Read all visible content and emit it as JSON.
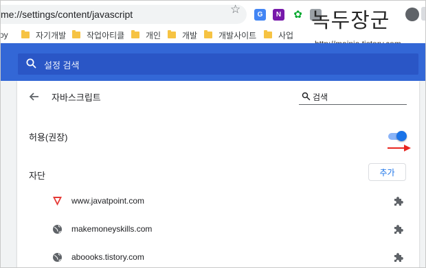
{
  "browser": {
    "url": "me://settings/content/javascript",
    "extensions": [
      {
        "name": "google-translate-icon",
        "glyph": "G",
        "color": "#4285f4"
      },
      {
        "name": "onenote-icon",
        "glyph": "N",
        "color": "#7719aa"
      },
      {
        "name": "evernote-icon",
        "glyph": "✿",
        "color": "#00a82d"
      }
    ]
  },
  "watermark": {
    "title": "녹두장군",
    "url": "http://mainia.tistory.com"
  },
  "bookmarks": [
    {
      "label": "oy"
    },
    {
      "label": "자기개발"
    },
    {
      "label": "작업아티클"
    },
    {
      "label": "개인"
    },
    {
      "label": "개발"
    },
    {
      "label": "개발사이트"
    },
    {
      "label": "사업"
    }
  ],
  "settings": {
    "search_placeholder": "설정 검색",
    "accent_color": "#3367d6"
  },
  "page": {
    "title": "자바스크립트",
    "search_placeholder": "검색",
    "allow_label": "허용(권장)",
    "allow_enabled": true,
    "block_label": "자단",
    "add_button": "추가",
    "blocked_sites": [
      {
        "url": "www.javatpoint.com",
        "icon": "javatpoint-favicon"
      },
      {
        "url": "makemoneyskills.com",
        "icon": "globe-icon"
      },
      {
        "url": "aboooks.tistory.com",
        "icon": "globe-icon"
      }
    ]
  }
}
